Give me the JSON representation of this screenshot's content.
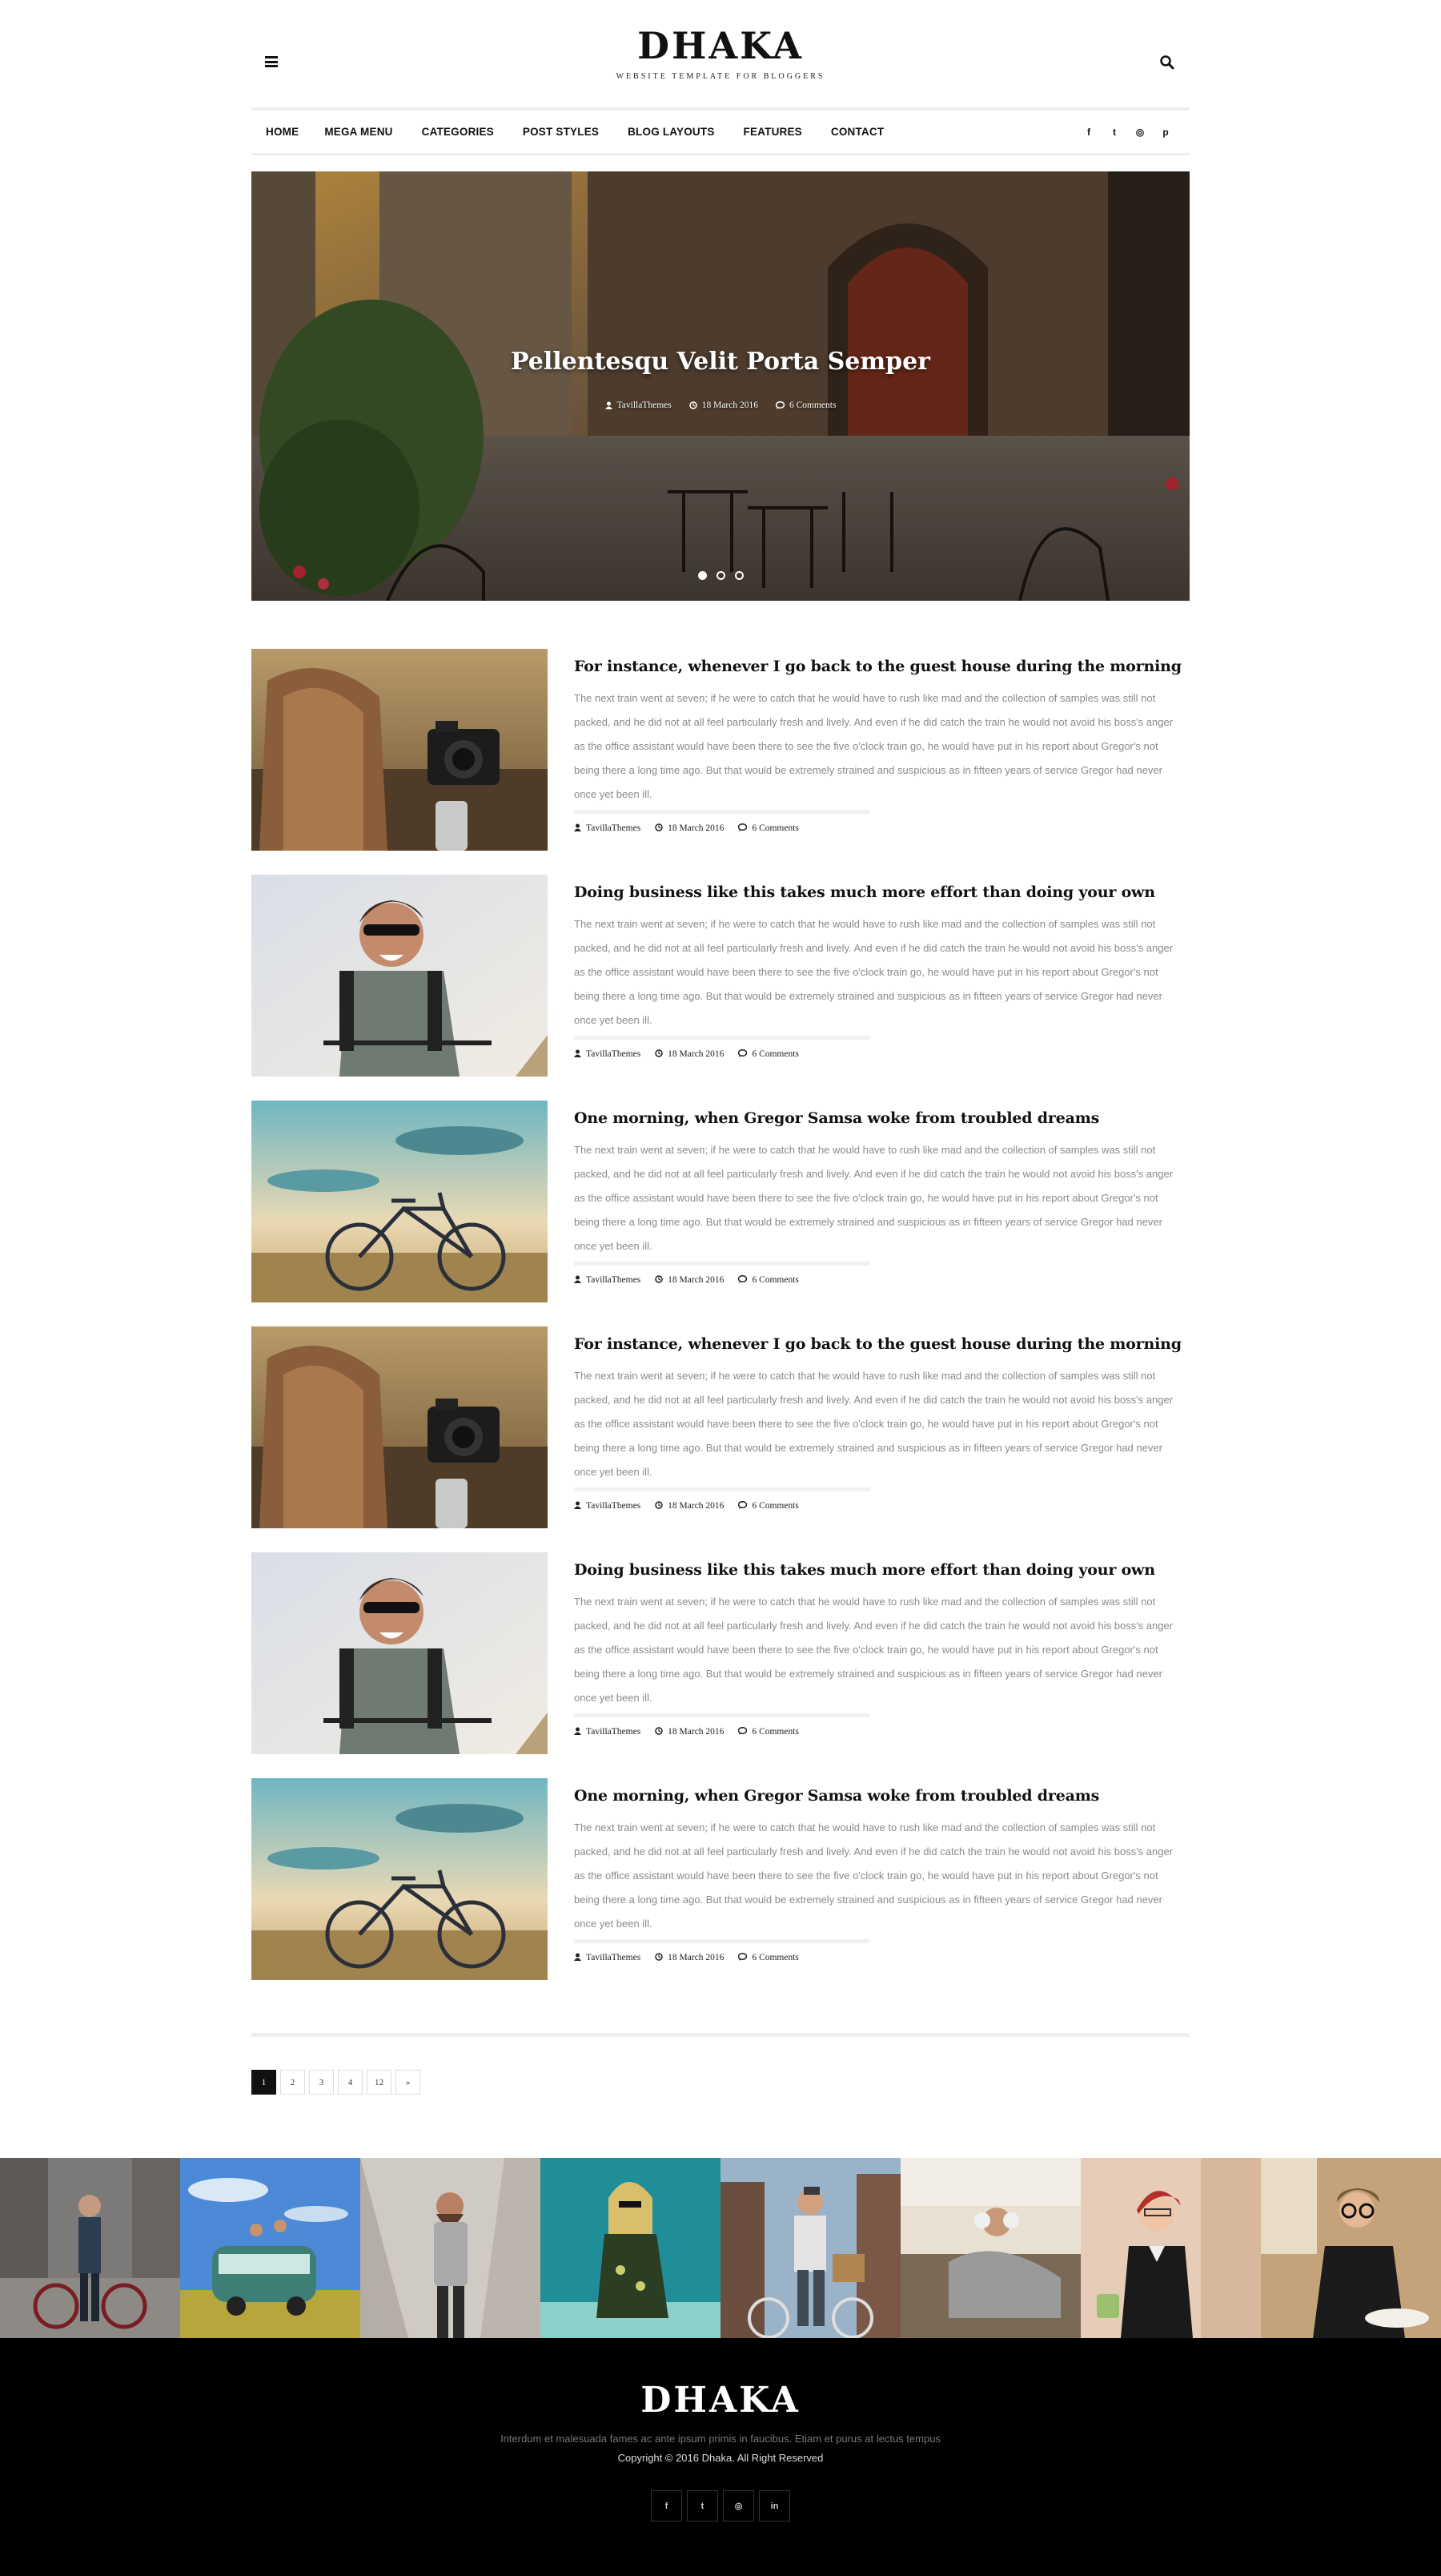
{
  "header": {
    "logo": "DHAKA",
    "tagline": "Website Template for Bloggers"
  },
  "nav": {
    "items": [
      {
        "label": "HOME"
      },
      {
        "label": "MEGA MENU"
      },
      {
        "label": "CATEGORIES"
      },
      {
        "label": "POST STYLES"
      },
      {
        "label": "BLOG LAYOUTS"
      },
      {
        "label": "FEATURES"
      },
      {
        "label": "CONTACT"
      }
    ],
    "social": [
      "facebook-icon",
      "twitter-icon",
      "instagram-icon",
      "pinterest-icon"
    ],
    "social_glyphs": [
      "f",
      "t",
      "◎",
      "p"
    ]
  },
  "hero": {
    "title": "Pellentesqu Velit Porta Semper",
    "author": "TavillaThemes",
    "date": "18 March 2016",
    "comments": "6 Comments",
    "slides": 3,
    "active_slide": 1
  },
  "posts": [
    {
      "image": "backpack-camera",
      "title": "For instance, whenever I go back to the guest house during the morning",
      "excerpt": "The next train went at seven; if he were to catch that he would have to rush like mad and the collection of samples was still not packed, and he did not at all feel particularly fresh and lively. And even if he did catch the train he would not avoid his boss's anger as the office assistant would have been there to see the five o'clock train go, he would have put in his report about Gregor's not being there a long time ago. But that would be extremely strained and suspicious as in fifteen years of service Gregor had never once yet been ill.",
      "author": "TavillaThemes",
      "date": "18 March 2016",
      "comments": "6 Comments"
    },
    {
      "image": "laughing-cyclist",
      "title": "Doing business like this takes much more effort than doing your own",
      "excerpt": "The next train went at seven; if he were to catch that he would have to rush like mad and the collection of samples was still not packed, and he did not at all feel particularly fresh and lively. And even if he did catch the train he would not avoid his boss's anger as the office assistant would have been there to see the five o'clock train go, he would have put in his report about Gregor's not being there a long time ago. But that would be extremely strained and suspicious as in fifteen years of service Gregor had never once yet been ill.",
      "author": "TavillaThemes",
      "date": "18 March 2016",
      "comments": "6 Comments"
    },
    {
      "image": "bicycle-field",
      "title": "One morning, when Gregor Samsa woke from troubled dreams",
      "excerpt": "The next train went at seven; if he were to catch that he would have to rush like mad and the collection of samples was still not packed, and he did not at all feel particularly fresh and lively. And even if he did catch the train he would not avoid his boss's anger as the office assistant would have been there to see the five o'clock train go, he would have put in his report about Gregor's not being there a long time ago. But that would be extremely strained and suspicious as in fifteen years of service Gregor had never once yet been ill.",
      "author": "TavillaThemes",
      "date": "18 March 2016",
      "comments": "6 Comments"
    },
    {
      "image": "backpack-camera",
      "title": "For instance, whenever I go back to the guest house during the morning",
      "excerpt": "The next train went at seven; if he were to catch that he would have to rush like mad and the collection of samples was still not packed, and he did not at all feel particularly fresh and lively. And even if he did catch the train he would not avoid his boss's anger as the office assistant would have been there to see the five o'clock train go, he would have put in his report about Gregor's not being there a long time ago. But that would be extremely strained and suspicious as in fifteen years of service Gregor had never once yet been ill.",
      "author": "TavillaThemes",
      "date": "18 March 2016",
      "comments": "6 Comments"
    },
    {
      "image": "laughing-cyclist",
      "title": "Doing business like this takes much more effort than doing your own",
      "excerpt": "The next train went at seven; if he were to catch that he would have to rush like mad and the collection of samples was still not packed, and he did not at all feel particularly fresh and lively. And even if he did catch the train he would not avoid his boss's anger as the office assistant would have been there to see the five o'clock train go, he would have put in his report about Gregor's not being there a long time ago. But that would be extremely strained and suspicious as in fifteen years of service Gregor had never once yet been ill.",
      "author": "TavillaThemes",
      "date": "18 March 2016",
      "comments": "6 Comments"
    },
    {
      "image": "bicycle-field",
      "title": "One morning, when Gregor Samsa woke from troubled dreams",
      "excerpt": "The next train went at seven; if he were to catch that he would have to rush like mad and the collection of samples was still not packed, and he did not at all feel particularly fresh and lively. And even if he did catch the train he would not avoid his boss's anger as the office assistant would have been there to see the five o'clock train go, he would have put in his report about Gregor's not being there a long time ago. But that would be extremely strained and suspicious as in fifteen years of service Gregor had never once yet been ill.",
      "author": "TavillaThemes",
      "date": "18 March 2016",
      "comments": "6 Comments"
    }
  ],
  "pagination": {
    "pages": [
      "1",
      "2",
      "3",
      "4",
      "...",
      "12",
      "»"
    ],
    "active": "1"
  },
  "instagram": {
    "tiles": [
      "man-with-bike",
      "friends-with-van",
      "bearded-man-phone",
      "woman-sunglasses",
      "cyclist-with-basket",
      "man-headphones",
      "woman-red-hair",
      "woman-glasses-cafe"
    ]
  },
  "footer": {
    "logo": "DHAKA",
    "text": "Interdum et malesuada fames ac ante ipsum primis in faucibus. Etiam et purus at lectus tempus",
    "copyright": "Copyright © 2016 Dhaka. All Right Reserved",
    "social": [
      "facebook-icon",
      "twitter-icon",
      "instagram-icon",
      "linkedin-icon"
    ],
    "social_glyphs": [
      "f",
      "t",
      "◎",
      "in"
    ]
  },
  "colors": {
    "text": "#111111",
    "muted": "#8a8a8a",
    "divider": "#eeeeee",
    "footer_bg": "#000000"
  }
}
